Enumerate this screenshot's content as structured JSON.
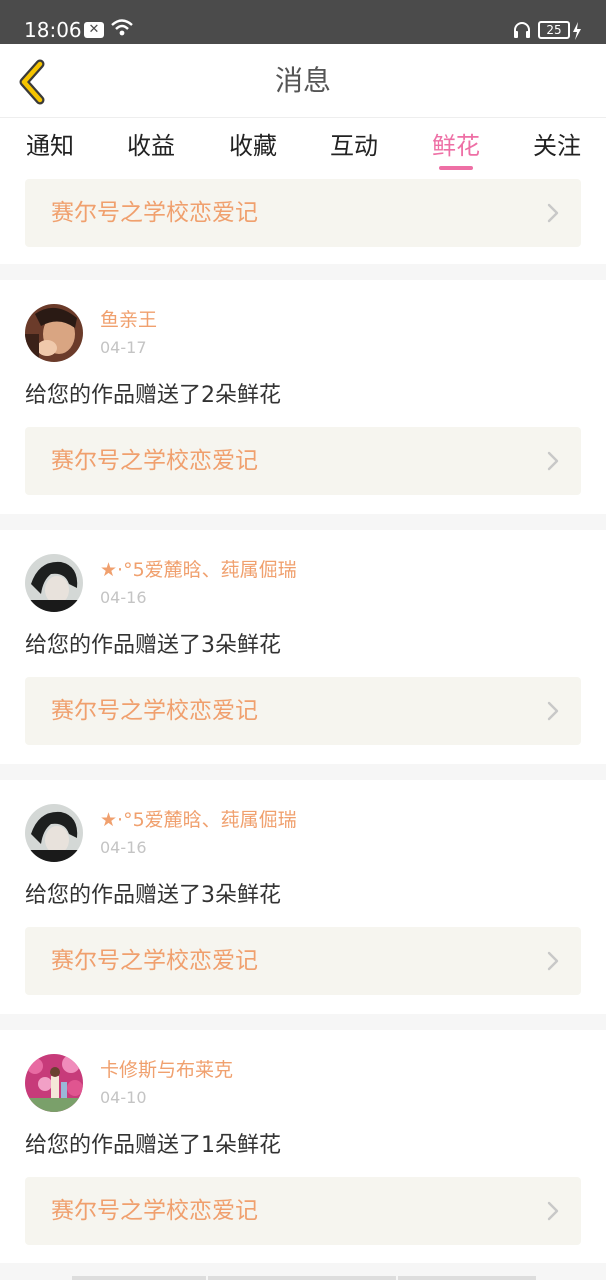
{
  "status_bar": {
    "time": "18:06",
    "battery": "25"
  },
  "header": {
    "title": "消息"
  },
  "tabs": [
    {
      "label": "通知"
    },
    {
      "label": "收益"
    },
    {
      "label": "收藏"
    },
    {
      "label": "互动"
    },
    {
      "label": "鲜花",
      "active": true
    },
    {
      "label": "关注"
    }
  ],
  "top_card": {
    "title": "赛尔号之学校恋爱记"
  },
  "items": [
    {
      "username": "鱼亲王",
      "date": "04-17",
      "message": "给您的作品赠送了2朵鲜花",
      "work_title": "赛尔号之学校恋爱记"
    },
    {
      "username": "★·°5爱麓晗、莼属倔瑞",
      "date": "04-16",
      "message": "给您的作品赠送了3朵鲜花",
      "work_title": "赛尔号之学校恋爱记"
    },
    {
      "username": "★·°5爱麓晗、莼属倔瑞",
      "date": "04-16",
      "message": "给您的作品赠送了3朵鲜花",
      "work_title": "赛尔号之学校恋爱记"
    },
    {
      "username": "卡修斯与布莱克",
      "date": "04-10",
      "message": "给您的作品赠送了1朵鲜花",
      "work_title": "赛尔号之学校恋爱记"
    }
  ],
  "colors": {
    "accent_pink": "#ee6fa5",
    "link_orange": "#f0a06e",
    "back_yellow": "#f5c400"
  },
  "icons": {
    "back": "chevron-left-icon",
    "card_arrow": "chevron-right-icon"
  }
}
